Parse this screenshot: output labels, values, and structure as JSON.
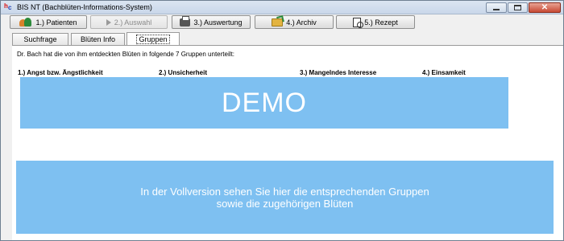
{
  "window": {
    "title": "BIS NT (Bachblüten-Informations-System)",
    "icon_letters": [
      "h",
      "c"
    ]
  },
  "toolbar": {
    "buttons": [
      {
        "label": "1.) Patienten",
        "icon": "patients-icon",
        "enabled": true
      },
      {
        "label": "2.) Auswahl",
        "icon": "play-icon",
        "enabled": false
      },
      {
        "label": "3.) Auswertung",
        "icon": "printer-icon",
        "enabled": true
      },
      {
        "label": "4.) Archiv",
        "icon": "folder-icon",
        "enabled": true
      },
      {
        "label": "5.) Rezept",
        "icon": "document-search-icon",
        "enabled": true
      }
    ]
  },
  "tabs": [
    {
      "label": "Suchfrage",
      "active": false
    },
    {
      "label": "Blüten Info",
      "active": false
    },
    {
      "label": "Gruppen",
      "active": true
    }
  ],
  "content": {
    "intro": "Dr. Bach hat die von ihm entdeckten Blüten in folgende 7 Gruppen unterteilt:",
    "groups": [
      "1.) Angst bzw. Ängstlichkeit",
      "2.) Unsicherheit",
      "3.) Mangelndes Interesse",
      "4.) Einsamkeit"
    ],
    "demo_label": "DEMO",
    "info_lines": [
      "In der Vollversion sehen Sie hier die entsprechenden Gruppen",
      "sowie die zugehörigen Blüten"
    ]
  },
  "colors": {
    "demo_box": "#7ec0f1",
    "close_button": "#c74a34"
  }
}
